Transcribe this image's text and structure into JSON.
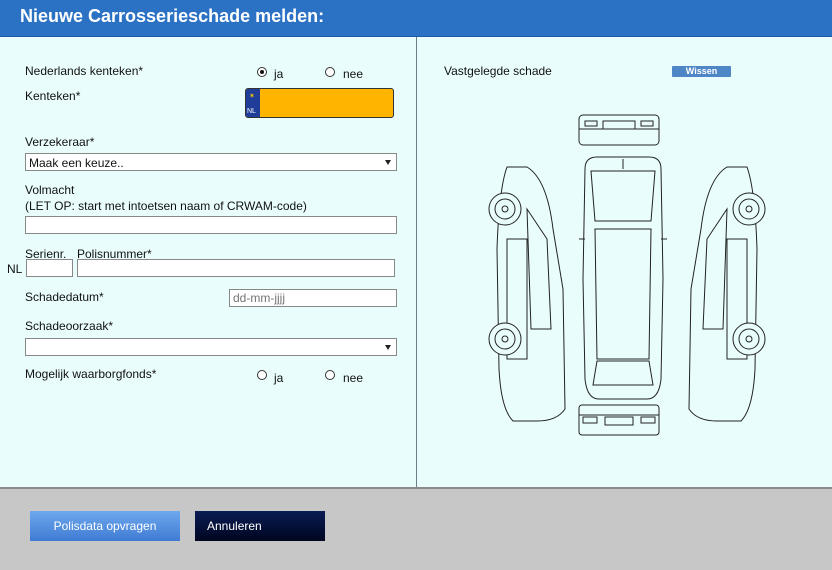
{
  "header": {
    "title": "Nieuwe Carrosserieschade melden:"
  },
  "form": {
    "nederlands_kenteken_label": "Nederlands kenteken*",
    "ja": "ja",
    "nee": "nee",
    "kenteken_label": "Kenteken*",
    "plate_country": "NL",
    "kenteken_value": "",
    "verzekeraar_label": "Verzekeraar*",
    "verzekeraar_value": "Maak een keuze..",
    "volmacht_label": "Volmacht",
    "volmacht_note": "(LET OP: start met intoetsen naam of CRWAM-code)",
    "volmacht_value": "",
    "nl_prefix": "NL",
    "serienr_label": "Serienr.",
    "polisnummer_label": "Polisnummer*",
    "schadedatum_label": "Schadedatum*",
    "schadedatum_value": "dd-mm-jjjj",
    "schadeoorzaak_label": "Schadeoorzaak*",
    "schadeoorzaak_value": "",
    "waarborgfonds_label": "Mogelijk waarborgfonds*"
  },
  "right": {
    "vastgelegde_label": "Vastgelegde schade",
    "wissen_label": "Wissen"
  },
  "footer": {
    "polisdata_label": "Polisdata opvragen",
    "annuleren_label": "Annuleren"
  },
  "colors": {
    "header": "#2c72c4",
    "plate": "#ffb400",
    "background": "#eafdfd"
  }
}
